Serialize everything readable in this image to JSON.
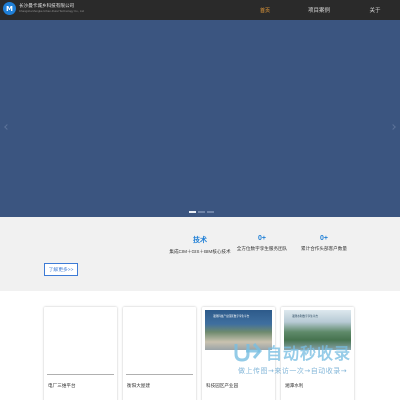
{
  "header": {
    "logo_mark": "M",
    "company_cn": "长沙曼卡城乡科技有限公司",
    "company_en": "Changsha Mengka Urban-Rural Technology Co., Ltd",
    "nav": [
      {
        "label": "首页",
        "active": true
      },
      {
        "label": "项目案例",
        "active": false
      },
      {
        "label": "关于",
        "active": false
      }
    ]
  },
  "banner": {
    "slide_count": 3,
    "active_slide": 1,
    "background": "#3b5580"
  },
  "stats": {
    "learn_more": "了解更多>>",
    "items": [
      {
        "value": "技术",
        "desc": "集成CIM＋GIS＋BIM核心技术"
      },
      {
        "value": "0+",
        "desc": "全方位数字孪生服务团队"
      },
      {
        "value": "0+",
        "desc": "累计合作头部客户数量"
      }
    ]
  },
  "cards": [
    {
      "title": "电厂三维平台",
      "image_caption": ""
    },
    {
      "title": "衡阳大屋建",
      "image_caption": ""
    },
    {
      "title": "科技园区产业园",
      "image_caption": "湘潭科技产业园区数字孪生平台"
    },
    {
      "title": "湘潭水利",
      "image_caption": "湘潭水利数字孪生平台"
    }
  ],
  "watermark": {
    "title": "自动秒收录",
    "subtitle": "做上传图→来访一次→自动收录→"
  },
  "colors": {
    "accent": "#1f7fd6",
    "nav_active": "#f2a33c",
    "header_bg": "#2a2a2a",
    "banner_bg": "#3b5580"
  }
}
